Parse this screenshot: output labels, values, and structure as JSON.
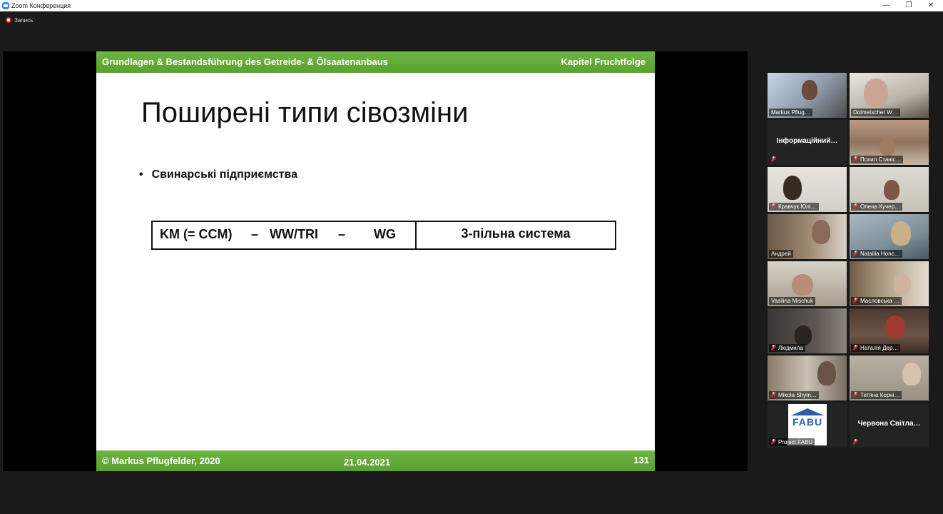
{
  "window": {
    "title": "Zoom Конференция",
    "min_glyph": "—",
    "max_glyph": "❐",
    "close_glyph": "✕"
  },
  "recording": {
    "label": "Запись"
  },
  "slide": {
    "header_left": "Grundlagen & Bestandsführung des Getreide- & Ölsaatenanbaus",
    "header_right": "Kapitel Fruchtfolge",
    "title": "Поширені типи сівозміни",
    "bullet_glyph": "•",
    "bullet": "Свинарські підприємства",
    "rotation": {
      "km": "KM (= CCM)",
      "dash1": "–",
      "wwtri": "WW/TRI",
      "dash2": "–",
      "wg": "WG",
      "system": "3-пільна система"
    },
    "footer_copyright": "© Markus Pflugfelder, 2020",
    "footer_date": "21.04.2021",
    "footer_page": "131",
    "accent_color": "#62ab38"
  },
  "participants": [
    {
      "name": "Markus Pflug…",
      "muted": false
    },
    {
      "name": "Dolmetscher W…",
      "muted": false
    },
    {
      "name": "Інформаційний…",
      "muted": true,
      "video": false
    },
    {
      "name": "Похил Станіс…",
      "muted": true
    },
    {
      "name": "Кравчук Юлі…",
      "muted": true
    },
    {
      "name": "Олена Кучер…",
      "muted": true
    },
    {
      "name": "Андрей",
      "muted": false
    },
    {
      "name": "Nataliia Honc…",
      "muted": true
    },
    {
      "name": "Vasilina Mischuk",
      "muted": false,
      "active_speaker": true
    },
    {
      "name": "Масловська …",
      "muted": true
    },
    {
      "name": "Людмила",
      "muted": true
    },
    {
      "name": "Наталія Дер…",
      "muted": true
    },
    {
      "name": "Mikola Shym…",
      "muted": true
    },
    {
      "name": "Тетяна Корні…",
      "muted": true
    },
    {
      "name": "Project FABU",
      "muted": true,
      "logo_text": "FABU"
    },
    {
      "name": "Червона Світла…",
      "muted": true,
      "video": false
    }
  ]
}
